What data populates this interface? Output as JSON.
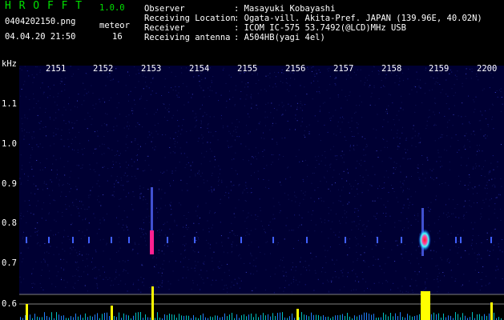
{
  "app": {
    "name": "H R O F F T",
    "version": "1.0.0"
  },
  "file": {
    "name": "0404202150.png",
    "datetime": "04.04.20 21:50"
  },
  "meteor": {
    "label": "meteor",
    "count": "16"
  },
  "info": {
    "observer_label": "Observer",
    "observer_value": ": Masayuki Kobayashi",
    "location_label": "Receiving Location",
    "location_value": ": Ogata-vill. Akita-Pref. JAPAN (139.96E, 40.02N)",
    "receiver_label": "Receiver",
    "receiver_value": ": ICOM IC-575 53.7492(@LCD)MHz USB",
    "antenna_label": "Receiving antenna",
    "antenna_value": ": A504HB(yagi 4el)"
  },
  "axis": {
    "y_unit": "kHz",
    "y_ticks": [
      "1.1",
      "1.0",
      "0.9",
      "0.8",
      "0.7",
      "0.6"
    ],
    "x_ticks": [
      "2151",
      "2152",
      "2153",
      "2154",
      "2155",
      "2156",
      "2157",
      "2158",
      "2159",
      "2200"
    ]
  },
  "colors": {
    "title": "#00e000",
    "text": "#ffffff",
    "plot_bg": "#000033",
    "burst": "#ff2020",
    "peak": "#ffff00",
    "cyan": "#00e0e0"
  }
}
